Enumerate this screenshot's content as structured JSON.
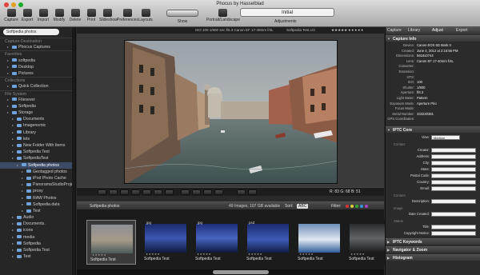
{
  "window": {
    "title": "Phocus by Hasselblad",
    "traffic_colors": [
      "#e0443e",
      "#dea123",
      "#1aab29"
    ]
  },
  "toolbar": {
    "tools": [
      {
        "name": "capture",
        "label": "Capture"
      },
      {
        "name": "export",
        "label": "Export"
      },
      {
        "name": "import",
        "label": "Import"
      },
      {
        "name": "modify",
        "label": "Modify"
      },
      {
        "name": "delete",
        "label": "Delete"
      },
      {
        "name": "print",
        "label": "Print"
      },
      {
        "name": "slideshow",
        "label": "Slideshow"
      },
      {
        "name": "preferences",
        "label": "Preferences"
      },
      {
        "name": "layouts",
        "label": "Layouts"
      }
    ],
    "show_label": "Show",
    "portrait_label": "Portrait/Landscape",
    "adjust_preset": "Initial",
    "adjust_label": "Adjustments"
  },
  "sidebar": {
    "search_value": "Softpedia photos",
    "items": [
      {
        "label": "Capture Destination",
        "level": 0,
        "type": "hdr"
      },
      {
        "label": "Phocus Captures",
        "level": 1,
        "type": "folder"
      },
      {
        "label": "Favorites",
        "level": 0,
        "type": "hdr"
      },
      {
        "label": "softpedia",
        "level": 1,
        "type": "folder"
      },
      {
        "label": "Desktop",
        "level": 1,
        "type": "folder"
      },
      {
        "label": "Pictures",
        "level": 1,
        "type": "folder"
      },
      {
        "label": "Collections",
        "level": 0,
        "type": "hdr"
      },
      {
        "label": "Quick Collection",
        "level": 1,
        "type": "folder"
      },
      {
        "label": "File System",
        "level": 0,
        "type": "hdr"
      },
      {
        "label": "Filesever",
        "level": 1,
        "type": "folder"
      },
      {
        "label": "Softpedia",
        "level": 1,
        "type": "folder"
      },
      {
        "label": "Storage",
        "level": 1,
        "type": "folder"
      },
      {
        "label": "Documents",
        "level": 2,
        "type": "folder"
      },
      {
        "label": "Imagenomic",
        "level": 2,
        "type": "folder"
      },
      {
        "label": "Library",
        "level": 2,
        "type": "folder"
      },
      {
        "label": "lets",
        "level": 2,
        "type": "folder"
      },
      {
        "label": "New Folder With Items",
        "level": 2,
        "type": "folder"
      },
      {
        "label": "Softpedia Test",
        "level": 2,
        "type": "folder"
      },
      {
        "label": "SoftpediaTest",
        "level": 2,
        "type": "folder"
      },
      {
        "label": "Softpedia photos",
        "level": 3,
        "type": "selected"
      },
      {
        "label": "Geotagged photos",
        "level": 4,
        "type": "folder"
      },
      {
        "label": "iPod Photo Cache",
        "level": 4,
        "type": "folder"
      },
      {
        "label": "PanoramaStudioProject",
        "level": 4,
        "type": "folder"
      },
      {
        "label": "proxy",
        "level": 4,
        "type": "folder"
      },
      {
        "label": "RAW Photos",
        "level": 4,
        "type": "folder"
      },
      {
        "label": "Softpedia.data",
        "level": 4,
        "type": "folder"
      },
      {
        "label": "Test",
        "level": 4,
        "type": "folder"
      },
      {
        "label": "Audio",
        "level": 2,
        "type": "folder"
      },
      {
        "label": "Documents.",
        "level": 2,
        "type": "folder"
      },
      {
        "label": "icons",
        "level": 2,
        "type": "folder"
      },
      {
        "label": "media",
        "level": 2,
        "type": "folder"
      },
      {
        "label": "Softpedia",
        "level": 2,
        "type": "folder"
      },
      {
        "label": "Softpedia Test",
        "level": 2,
        "type": "folder"
      },
      {
        "label": "Test",
        "level": 2,
        "type": "folder"
      }
    ]
  },
  "viewer": {
    "info_left": "ISO 100   1/800 sec   f/6.3   Canon EF 17-40mm f/4L",
    "info_mid": "Softpedia Test.cr2",
    "info_stars": "★★★★★  ● ● ● ● ●",
    "readout": "R: 83  G: 68  B: 51"
  },
  "browser": {
    "folder": "Softpedia photos",
    "count_text": "49 Images, 107 GB available",
    "sort_label": "Sort:",
    "sort_value": "ABC",
    "filter_label": "Filter:",
    "thumbs": [
      {
        "caption": "Softpedia Test",
        "fmt": "",
        "selected": true
      },
      {
        "caption": "Softpedia Test",
        "fmt": "jpg",
        "selected": false
      },
      {
        "caption": "Softpedia Test",
        "fmt": "jpg",
        "selected": false
      },
      {
        "caption": "Softpedia Test",
        "fmt": "psd",
        "selected": false
      },
      {
        "caption": "Softpedia Test",
        "fmt": "",
        "selected": false
      },
      {
        "caption": "Softpedia Test",
        "fmt": "",
        "selected": false
      }
    ]
  },
  "right": {
    "tabs": [
      "Capture",
      "Library",
      "Adjust",
      "Export"
    ],
    "capture_info_title": "Capture Info",
    "capture_info": [
      {
        "k": "Device:",
        "v": "Canon EOS 5D Mark II"
      },
      {
        "k": "Created:",
        "v": "June 4, 2012 at 2:16:56 PM"
      },
      {
        "k": "Dimensions:",
        "v": "5616x3744"
      },
      {
        "k": "Lens:",
        "v": "Canon EF 17-40mm f/4L"
      },
      {
        "k": "Converter:",
        "v": ""
      },
      {
        "k": "Extension:",
        "v": ""
      },
      {
        "k": "HTS:",
        "v": ""
      },
      {
        "k": "ISO:",
        "v": "100"
      },
      {
        "k": "Shutter:",
        "v": "1/800"
      },
      {
        "k": "Aperture:",
        "v": "f/6.3"
      },
      {
        "k": "Light Meter:",
        "v": "Pattern"
      },
      {
        "k": "Exposure Mode:",
        "v": "Aperture Prio"
      },
      {
        "k": "Focus Mode:",
        "v": ""
      },
      {
        "k": "Serial Number:",
        "v": "333220381"
      },
      {
        "k": "GPS Coordinates:",
        "v": ""
      }
    ],
    "iptc_title": "IPTC Core",
    "iptc_view_label": "View:",
    "iptc_view_value": "Medium",
    "contact_group": "Contact",
    "iptc_contact": [
      "Creator:",
      "Address:",
      "City:",
      "State:",
      "Postal Code:",
      "Country:",
      "Email:"
    ],
    "content_group": "Content",
    "iptc_content": [
      "Description:"
    ],
    "image_group": "Image",
    "iptc_image": [
      "Date Created:"
    ],
    "status_group": "Status",
    "iptc_status": [
      "Title:",
      "Copyright Notice:"
    ],
    "iptc_keywords": "IPTC Keywords",
    "navigator": "Navigator & Zoom",
    "histogram": "Histogram"
  }
}
